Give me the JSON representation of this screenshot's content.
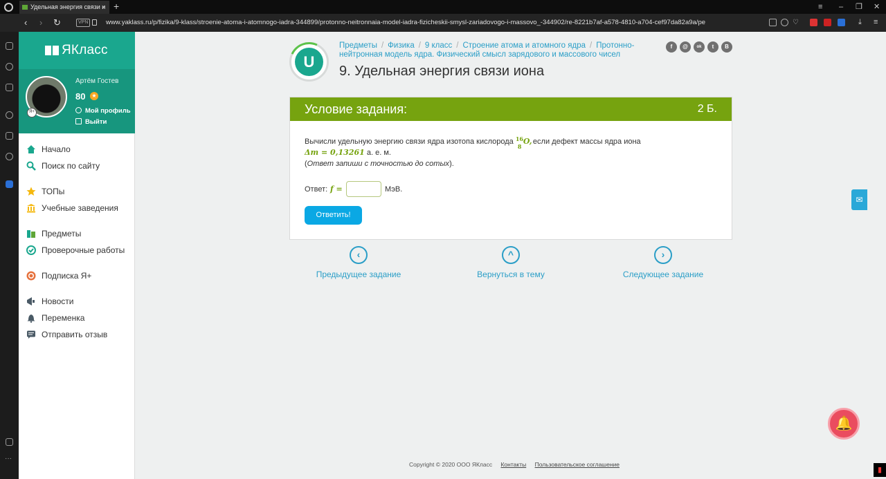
{
  "browser": {
    "tab_title": "Удельная энергия связи и",
    "tab_close": "×",
    "new_tab": "+",
    "url": "www.yaklass.ru/p/fizika/9-klass/stroenie-atoma-i-atomnogo-iadra-344899/protonno-neitronnaia-model-iadra-fizicheskii-smysl-zariadovogo-i-massovo_-344902/re-8221b7af-a578-4810-a704-cef97da82a9a/pe",
    "vpn_label": "VPN",
    "back": "‹",
    "forward": "›",
    "reload": "↻"
  },
  "sidebar": {
    "brand": "ЯКласс",
    "user_name": "Артём Гостев",
    "points": "80",
    "points_icon": "★",
    "avatar_badge": "Я+",
    "profile_link": "Мой профиль",
    "logout_link": "Выйти",
    "items": [
      {
        "label": "Начало",
        "icon": "home-icon"
      },
      {
        "label": "Поиск по сайту",
        "icon": "search-icon"
      },
      {
        "label": "ТОПы",
        "icon": "star-icon"
      },
      {
        "label": "Учебные заведения",
        "icon": "school-icon"
      },
      {
        "label": "Предметы",
        "icon": "books-icon"
      },
      {
        "label": "Проверочные работы",
        "icon": "check-icon"
      },
      {
        "label": "Подписка Я+",
        "icon": "subscription-icon"
      },
      {
        "label": "Новости",
        "icon": "news-icon"
      },
      {
        "label": "Переменка",
        "icon": "bell-icon"
      },
      {
        "label": "Отправить отзыв",
        "icon": "feedback-icon"
      }
    ]
  },
  "breadcrumbs": [
    "Предметы",
    "Физика",
    "9 класс",
    "Строение атома и атомного ядра",
    "Протонно-нейтронная модель ядра. Физический смысл зарядового и массового чисел"
  ],
  "page_title": "9. Удельная энергия связи иона",
  "logo_letter": "U",
  "social": [
    "f",
    "@",
    "ok",
    "t",
    "B"
  ],
  "task": {
    "header": "Условие задания:",
    "points": "2 Б.",
    "text_before": "Вычисли удельную энергию связи ядра изотопа кислорода",
    "isotope_mass": "16",
    "isotope_charge": "8",
    "isotope_symbol": "O,",
    "text_after": " если дефект массы ядра иона",
    "mass_defect": "Δm = 0,13261",
    "mass_unit": " а. е. м.",
    "note_open": "(",
    "note": "Ответ запиши с точностью до сотых",
    "note_close": ").",
    "answer_label": "Ответ:",
    "answer_var": "f =",
    "answer_value": "",
    "answer_unit": "МэВ.",
    "submit_label": "Ответить!"
  },
  "navigation": {
    "prev": "Предыдущее задание",
    "up": "Вернуться в тему",
    "next": "Следующее задание"
  },
  "footer": {
    "copyright": "Copyright © 2020 ООО ЯКласс",
    "contacts": "Контакты",
    "terms": "Пользовательское соглашение"
  },
  "colors": {
    "brand": "#1aa78e",
    "task_header": "#76a30f",
    "link": "#2a9ec7",
    "button": "#0aa8e4"
  }
}
